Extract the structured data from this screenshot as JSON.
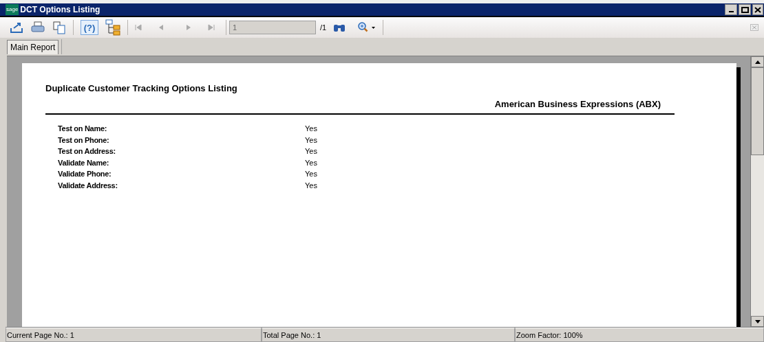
{
  "window": {
    "logo": "sage",
    "title": "DCT Options Listing"
  },
  "toolbar": {
    "help": "(?)",
    "page_input": "1",
    "page_total": "/1"
  },
  "tabs": [
    {
      "label": "Main Report",
      "selected": true
    }
  ],
  "report": {
    "title": "Duplicate Customer Tracking Options Listing",
    "company": "American Business Expressions (ABX)",
    "options": [
      {
        "label": "Test on Name:",
        "value": "Yes"
      },
      {
        "label": "Test on Phone:",
        "value": "Yes"
      },
      {
        "label": "Test on Address:",
        "value": "Yes"
      },
      {
        "label": "Validate Name:",
        "value": "Yes"
      },
      {
        "label": "Validate Phone:",
        "value": "Yes"
      },
      {
        "label": "Validate Address:",
        "value": "Yes"
      }
    ]
  },
  "status_bar": [
    "Current Page No.: 1",
    "Total Page No.: 1",
    "Zoom Factor: 100%"
  ]
}
